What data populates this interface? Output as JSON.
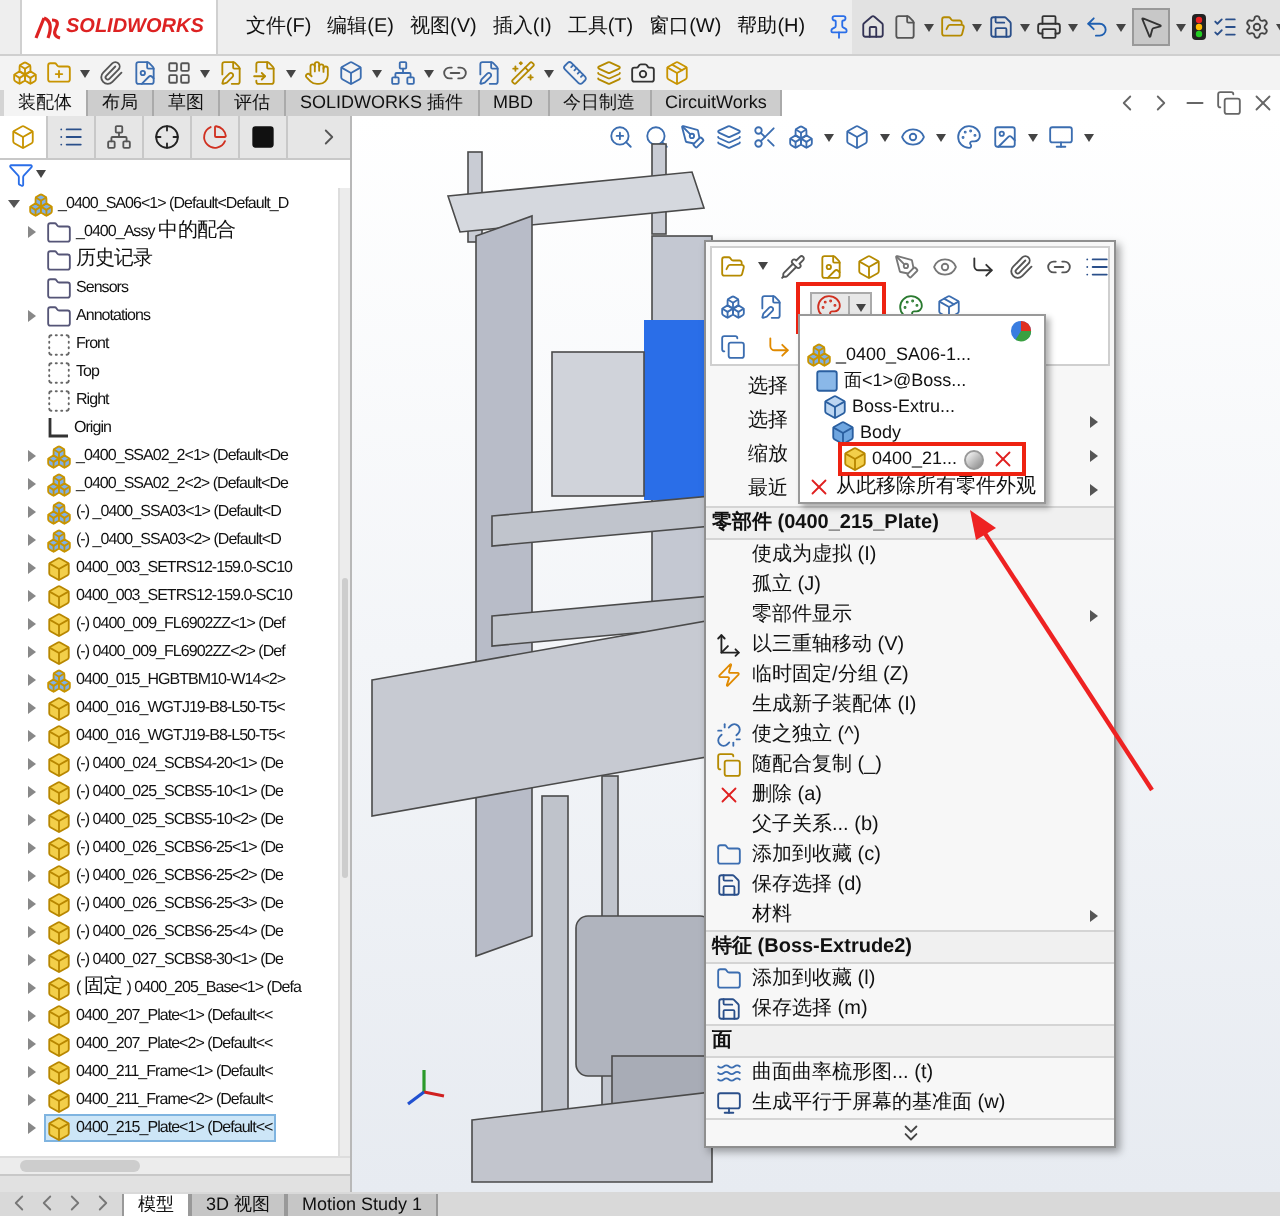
{
  "app": {
    "logo": "SOLIDWORKS",
    "menus": [
      "文件(F)",
      "编辑(E)",
      "视图(V)",
      "插入(I)",
      "工具(T)",
      "窗口(W)",
      "帮助(H)"
    ]
  },
  "command_tabs": [
    {
      "label": "装配体",
      "selected": true
    },
    {
      "label": "布局",
      "selected": false
    },
    {
      "label": "草图",
      "selected": false
    },
    {
      "label": "评估",
      "selected": false
    },
    {
      "label": "SOLIDWORKS 插件",
      "selected": false
    },
    {
      "label": "MBD",
      "selected": false
    },
    {
      "label": "今日制造",
      "selected": false
    },
    {
      "label": "CircuitWorks",
      "selected": false
    }
  ],
  "feature_tree": {
    "root": {
      "label": "_0400_SA06<1> (Default<Default_D",
      "kind": "assembly",
      "expandable": true,
      "expanded": true,
      "selected": false,
      "children": [
        {
          "label": "_0400_Assy 中的配合",
          "kind": "folder",
          "expandable": true,
          "expanded": false,
          "selected": false
        },
        {
          "label": "历史记录",
          "kind": "folder",
          "expandable": false,
          "expanded": false,
          "selected": false
        },
        {
          "label": "Sensors",
          "kind": "folder",
          "expandable": false,
          "expanded": false,
          "selected": false
        },
        {
          "label": "Annotations",
          "kind": "folder",
          "expandable": true,
          "expanded": false,
          "selected": false
        },
        {
          "label": "Front",
          "kind": "plane",
          "expandable": false,
          "expanded": false,
          "selected": false
        },
        {
          "label": "Top",
          "kind": "plane",
          "expandable": false,
          "expanded": false,
          "selected": false
        },
        {
          "label": "Right",
          "kind": "plane",
          "expandable": false,
          "expanded": false,
          "selected": false
        },
        {
          "label": "Origin",
          "kind": "origin",
          "expandable": false,
          "expanded": false,
          "selected": false
        },
        {
          "label": "_0400_SSA02_2<1> (Default<De",
          "kind": "assembly",
          "expandable": true,
          "expanded": false,
          "selected": false
        },
        {
          "label": "_0400_SSA02_2<2> (Default<De",
          "kind": "assembly",
          "expandable": true,
          "expanded": false,
          "selected": false
        },
        {
          "label": "(-) _0400_SSA03<1> (Default<D",
          "kind": "assembly",
          "expandable": true,
          "expanded": false,
          "selected": false
        },
        {
          "label": "(-) _0400_SSA03<2> (Default<D",
          "kind": "assembly",
          "expandable": true,
          "expanded": false,
          "selected": false
        },
        {
          "label": "0400_003_SETRS12-159.0-SC10",
          "kind": "part",
          "expandable": true,
          "expanded": false,
          "selected": false
        },
        {
          "label": "0400_003_SETRS12-159.0-SC10",
          "kind": "part",
          "expandable": true,
          "expanded": false,
          "selected": false
        },
        {
          "label": "(-) 0400_009_FL6902ZZ<1> (Def",
          "kind": "part",
          "expandable": true,
          "expanded": false,
          "selected": false
        },
        {
          "label": "(-) 0400_009_FL6902ZZ<2> (Def",
          "kind": "part",
          "expandable": true,
          "expanded": false,
          "selected": false
        },
        {
          "label": "0400_015_HGBTBM10-W14<2>",
          "kind": "assembly",
          "expandable": true,
          "expanded": false,
          "selected": false
        },
        {
          "label": "0400_016_WGTJ19-B8-L50-T5<",
          "kind": "part",
          "expandable": true,
          "expanded": false,
          "selected": false
        },
        {
          "label": "0400_016_WGTJ19-B8-L50-T5<",
          "kind": "part",
          "expandable": true,
          "expanded": false,
          "selected": false
        },
        {
          "label": "(-) 0400_024_SCBS4-20<1> (De",
          "kind": "part",
          "expandable": true,
          "expanded": false,
          "selected": false
        },
        {
          "label": "(-) 0400_025_SCBS5-10<1> (De",
          "kind": "part",
          "expandable": true,
          "expanded": false,
          "selected": false
        },
        {
          "label": "(-) 0400_025_SCBS5-10<2> (De",
          "kind": "part",
          "expandable": true,
          "expanded": false,
          "selected": false
        },
        {
          "label": "(-) 0400_026_SCBS6-25<1> (De",
          "kind": "part",
          "expandable": true,
          "expanded": false,
          "selected": false
        },
        {
          "label": "(-) 0400_026_SCBS6-25<2> (De",
          "kind": "part",
          "expandable": true,
          "expanded": false,
          "selected": false
        },
        {
          "label": "(-) 0400_026_SCBS6-25<3> (De",
          "kind": "part",
          "expandable": true,
          "expanded": false,
          "selected": false
        },
        {
          "label": "(-) 0400_026_SCBS6-25<4> (De",
          "kind": "part",
          "expandable": true,
          "expanded": false,
          "selected": false
        },
        {
          "label": "(-) 0400_027_SCBS8-30<1> (De",
          "kind": "part",
          "expandable": true,
          "expanded": false,
          "selected": false
        },
        {
          "label": "(固定) 0400_205_Base<1> (Defa",
          "kind": "part",
          "expandable": true,
          "expanded": false,
          "selected": false
        },
        {
          "label": "0400_207_Plate<1> (Default<<",
          "kind": "part",
          "expandable": true,
          "expanded": false,
          "selected": false
        },
        {
          "label": "0400_207_Plate<2> (Default<<",
          "kind": "part",
          "expandable": true,
          "expanded": false,
          "selected": false
        },
        {
          "label": "0400_211_Frame<1> (Default<",
          "kind": "part",
          "expandable": true,
          "expanded": false,
          "selected": false
        },
        {
          "label": "0400_211_Frame<2> (Default<",
          "kind": "part",
          "expandable": true,
          "expanded": false,
          "selected": false
        },
        {
          "label": "0400_215_Plate<1> (Default<<",
          "kind": "part",
          "expandable": true,
          "expanded": false,
          "selected": true
        }
      ]
    }
  },
  "panel_tabs": [
    {
      "selected": true
    },
    {
      "selected": false
    },
    {
      "selected": false
    },
    {
      "selected": false
    },
    {
      "selected": false
    },
    {
      "selected": false
    }
  ],
  "bottom_tabs": [
    {
      "label": "模型",
      "selected": true
    },
    {
      "label": "3D 视图",
      "selected": false
    },
    {
      "label": "Motion Study 1",
      "selected": false
    }
  ],
  "annotation_arrow": true,
  "context_menu": {
    "appearance_button": {
      "annotated": true
    },
    "covered_items": [
      {
        "label": "选择",
        "submenu": false
      },
      {
        "label": "选择",
        "submenu": true
      },
      {
        "label": "缩放",
        "submenu": true
      },
      {
        "label": "最近",
        "submenu": true
      }
    ],
    "appearance_dropdown": {
      "tree": [
        {
          "label": "_0400_SA06-1...",
          "kind": "assembly",
          "annotated": false,
          "children": [
            {
              "label": "面<1>@Boss...",
              "kind": "face",
              "annotated": false,
              "children": [
                {
                  "label": "Boss-Extru...",
                  "kind": "feature",
                  "annotated": false,
                  "children": [
                    {
                      "label": "Body",
                      "kind": "body",
                      "annotated": false,
                      "children": [
                        {
                          "label": "0400_21...",
                          "kind": "part",
                          "annotated": true
                        }
                      ]
                    }
                  ]
                }
              ]
            }
          ]
        }
      ],
      "remove_all": "从此移除所有零件外观"
    },
    "sections": [
      {
        "title": "零部件 (0400_215_Plate)",
        "items": [
          {
            "label": "使成为虚拟 (I)",
            "submenu": false
          },
          {
            "label": "孤立 (J)",
            "submenu": false
          },
          {
            "label": "零部件显示",
            "submenu": true
          },
          {
            "label": "以三重轴移动 (V)",
            "submenu": false
          },
          {
            "label": "临时固定/分组 (Z)",
            "submenu": false
          },
          {
            "label": "生成新子装配体 (I)",
            "submenu": false
          },
          {
            "label": "使之独立 (^)",
            "submenu": false
          },
          {
            "label": "随配合复制 (_)",
            "submenu": false
          },
          {
            "label": "删除 (a)",
            "submenu": false
          },
          {
            "label": "父子关系... (b)",
            "submenu": false
          },
          {
            "label": "添加到收藏 (c)",
            "submenu": false
          },
          {
            "label": "保存选择 (d)",
            "submenu": false
          },
          {
            "label": "材料",
            "submenu": true
          }
        ]
      },
      {
        "title": "特征 (Boss-Extrude2)",
        "items": [
          {
            "label": "添加到收藏 (l)",
            "submenu": false
          },
          {
            "label": "保存选择 (m)",
            "submenu": false
          }
        ]
      },
      {
        "title": "面",
        "items": [
          {
            "label": "曲面曲率梳形图... (t)",
            "submenu": false
          },
          {
            "label": "生成平行于屏幕的基准面 (w)",
            "submenu": false
          }
        ]
      }
    ]
  }
}
